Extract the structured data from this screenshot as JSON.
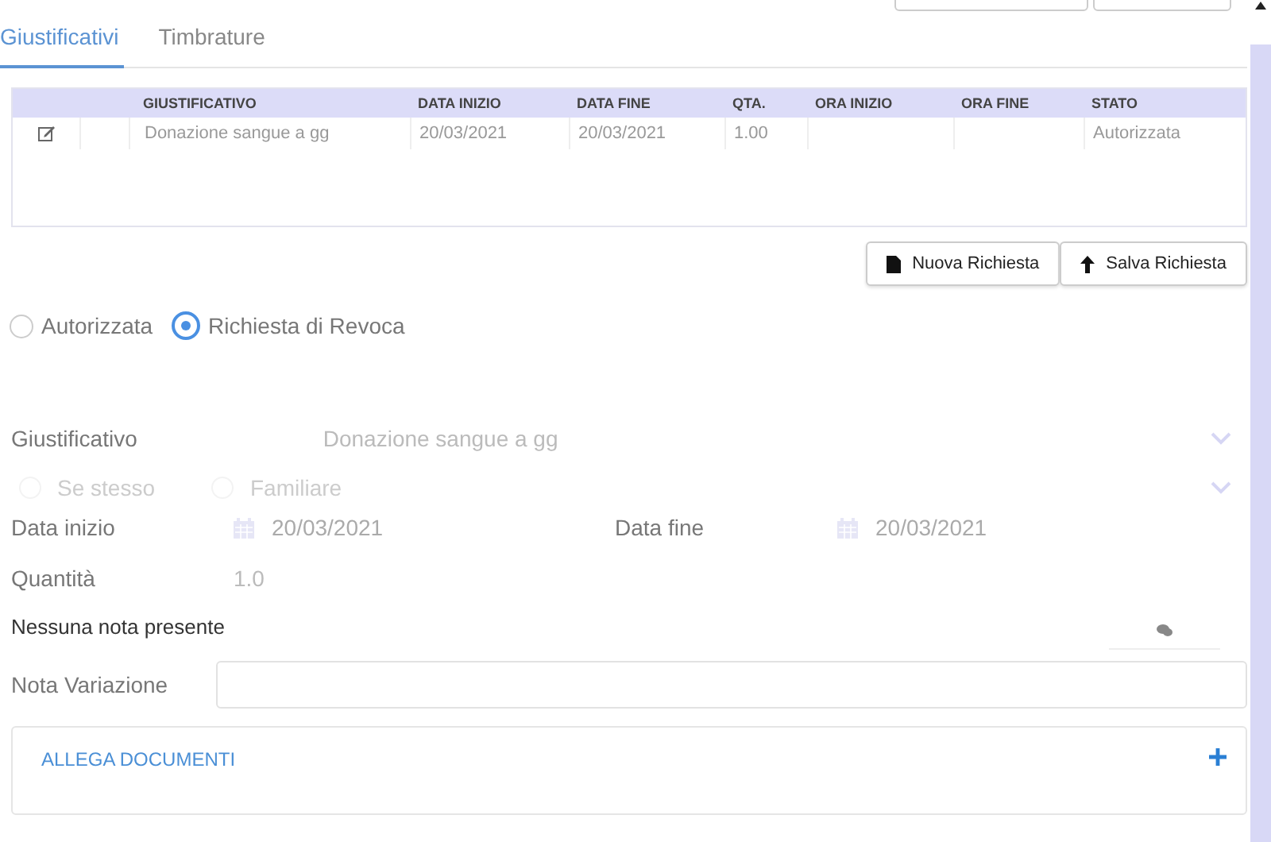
{
  "tabs": [
    {
      "label": "Giustificativi",
      "selected": true
    },
    {
      "label": "Timbrature",
      "selected": false
    }
  ],
  "table": {
    "columns": [
      "GIUSTIFICATIVO",
      "DATA INIZIO",
      "DATA FINE",
      "QTA.",
      "ORA INIZIO",
      "ORA FINE",
      "STATO"
    ],
    "rows": [
      {
        "cells": [
          "Donazione sangue a gg",
          "20/03/2021",
          "20/03/2021",
          "1.00",
          "",
          "",
          "Autorizzata"
        ]
      }
    ]
  },
  "buttons": [
    {
      "label": "Nuova Richiesta",
      "kind": "file"
    },
    {
      "label": "Salva Richiesta",
      "kind": "upload"
    }
  ],
  "status_options": [
    {
      "label": "Autorizzata",
      "selected": false
    },
    {
      "label": "Richiesta di Revoca",
      "selected": true
    }
  ],
  "form": {
    "giustificativo": {
      "label": "Giustificativo",
      "value": "Donazione sangue a gg"
    },
    "beneficiary_options": [
      {
        "label": "Se stesso",
        "selected": false
      },
      {
        "label": "Familiare",
        "selected": false
      }
    ],
    "data_inizio": {
      "label": "Data inizio",
      "value": "20/03/2021"
    },
    "data_fine": {
      "label": "Data fine",
      "value": "20/03/2021"
    },
    "quantita": {
      "label": "Quantità",
      "value": "1.0"
    },
    "notes": "Nessuna nota presente",
    "nota_variazione": {
      "label": "Nota Variazione"
    }
  },
  "attachments": {
    "title": "ALLEGA DOCUMENTI"
  }
}
